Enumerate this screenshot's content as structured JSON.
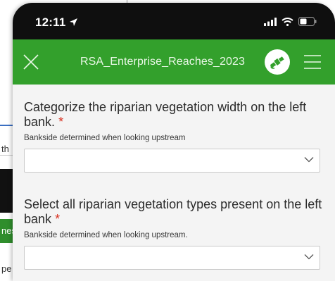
{
  "background": {
    "text_1": "th",
    "text_2": "nes",
    "text_3": "pe"
  },
  "status_bar": {
    "time": "12:11"
  },
  "header": {
    "title": "RSA_Enterprise_Reaches_2023",
    "color": "#33a02c"
  },
  "questions": [
    {
      "label": "Categorize the riparian vegetation width on the left bank.",
      "required_mark": "*",
      "hint": "Bankside determined when looking upstream",
      "value": ""
    },
    {
      "label": "Select all riparian vegetation types present on the left bank",
      "required_mark": "*",
      "hint": "Bankside determined when looking upstream.",
      "value": ""
    }
  ],
  "icons": {
    "close": "close-icon",
    "gps": "gps-satellite-icon",
    "menu": "hamburger-menu-icon",
    "location": "location-arrow-icon",
    "signal": "cellular-signal-icon",
    "wifi": "wifi-icon",
    "battery": "battery-icon",
    "chevron": "chevron-down-icon"
  }
}
